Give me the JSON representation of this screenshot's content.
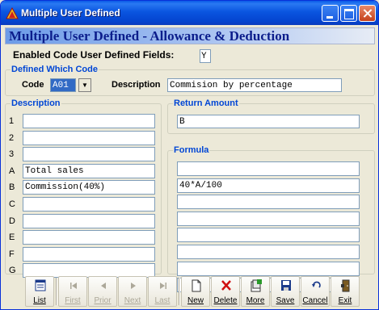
{
  "window": {
    "title": "Multiple User Defined"
  },
  "banner": {
    "text": "Multiple User Defined - Allowance & Deduction"
  },
  "enabled": {
    "label": "Enabled Code User Defined Fields:",
    "value": "Y"
  },
  "which_code": {
    "legend": "Defined Which Code",
    "code_label": "Code",
    "code_value": "A01",
    "description_label": "Description",
    "description_value": "Commision by percentage"
  },
  "description_group": {
    "legend": "Description",
    "rows": [
      {
        "label": "1",
        "value": ""
      },
      {
        "label": "2",
        "value": ""
      },
      {
        "label": "3",
        "value": ""
      },
      {
        "label": "A",
        "value": "Total sales"
      },
      {
        "label": "B",
        "value": "Commission(40%)"
      },
      {
        "label": "C",
        "value": ""
      },
      {
        "label": "D",
        "value": ""
      },
      {
        "label": "E",
        "value": ""
      },
      {
        "label": "F",
        "value": ""
      },
      {
        "label": "G",
        "value": ""
      }
    ]
  },
  "return_group": {
    "legend": "Return Amount",
    "value": "B"
  },
  "formula_group": {
    "legend": "Formula",
    "rows": [
      "",
      "40*A/100",
      "",
      "",
      "",
      "",
      "",
      ""
    ]
  },
  "toolbar": {
    "buttons": [
      {
        "label": "List",
        "icon": "list-icon",
        "enabled": true
      },
      {
        "label": "First",
        "icon": "first-icon",
        "enabled": false
      },
      {
        "label": "Prior",
        "icon": "prior-icon",
        "enabled": false
      },
      {
        "label": "Next",
        "icon": "next-icon",
        "enabled": false
      },
      {
        "label": "Last",
        "icon": "last-icon",
        "enabled": false
      },
      {
        "label": "New",
        "icon": "new-document-icon",
        "enabled": true
      },
      {
        "label": "Delete",
        "icon": "delete-icon",
        "enabled": true
      },
      {
        "label": "More",
        "icon": "more-icon",
        "enabled": true
      },
      {
        "label": "Save",
        "icon": "save-icon",
        "enabled": true
      },
      {
        "label": "Cancel",
        "icon": "cancel-icon",
        "enabled": true
      },
      {
        "label": "Exit",
        "icon": "exit-icon",
        "enabled": true
      }
    ]
  },
  "colors": {
    "titlebar": "#0a55e0",
    "banner_text": "#0c1e8c",
    "legend": "#0046d5"
  }
}
